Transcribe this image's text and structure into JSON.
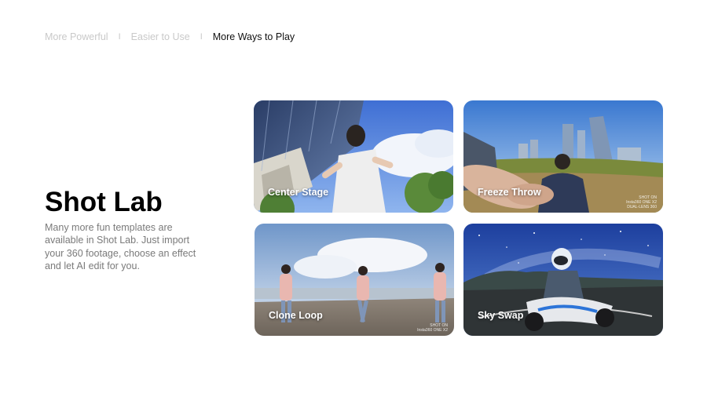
{
  "tabs": [
    {
      "label": "More Powerful",
      "active": false
    },
    {
      "label": "Easier to Use",
      "active": false
    },
    {
      "label": "More Ways to Play",
      "active": true
    }
  ],
  "tab_separator": "I",
  "section": {
    "title": "Shot Lab",
    "description": "Many more fun templates are available in Shot Lab. Just import your 360 footage, choose an effect and let AI edit for you."
  },
  "cards": [
    {
      "label": "Center Stage",
      "watermark": []
    },
    {
      "label": "Freeze Throw",
      "watermark": [
        "SHOT ON",
        "Insta360 ONE X2",
        "DUAL-LENS 360"
      ]
    },
    {
      "label": "Clone Loop",
      "watermark": [
        "SHOT ON",
        "Insta360 ONE X2"
      ]
    },
    {
      "label": "Sky Swap",
      "watermark": []
    }
  ],
  "colors": {
    "active_tab": "#111111",
    "inactive_tab": "#c9c9c9",
    "title": "#000000",
    "description": "#7a7a7a",
    "card_label": "#ffffff"
  }
}
